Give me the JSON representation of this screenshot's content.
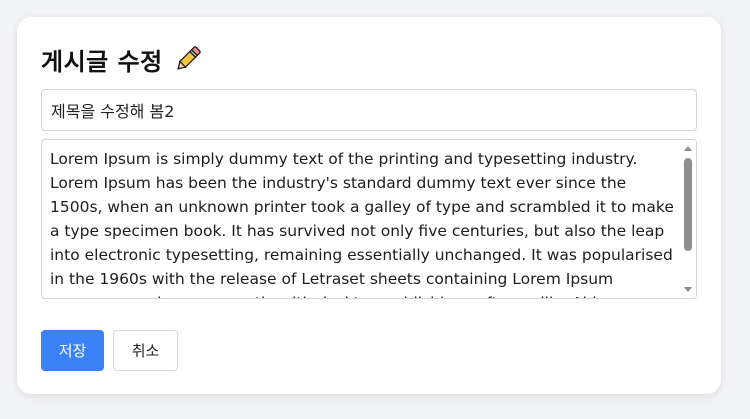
{
  "page": {
    "heading": "게시글 수정",
    "heading_icon": "pencil-icon"
  },
  "form": {
    "title_value": "제목을 수정해 봄2",
    "content_value": "Lorem Ipsum is simply dummy text of the printing and typesetting industry. Lorem Ipsum has been the industry's standard dummy text ever since the 1500s, when an unknown printer took a galley of type and scrambled it to make a type specimen book. It has survived not only five centuries, but also the leap into electronic typesetting, remaining essentially unchanged. It was popularised in the 1960s with the release of Letraset sheets containing Lorem Ipsum passages, and more recently with desktop publishing software like Aldus PageMaker including versions of Lorem Ipsum."
  },
  "actions": {
    "save_label": "저장",
    "cancel_label": "취소"
  },
  "colors": {
    "primary": "#3b82f6",
    "background": "#f2f3f5",
    "card": "#ffffff",
    "border": "#cfd4da"
  }
}
